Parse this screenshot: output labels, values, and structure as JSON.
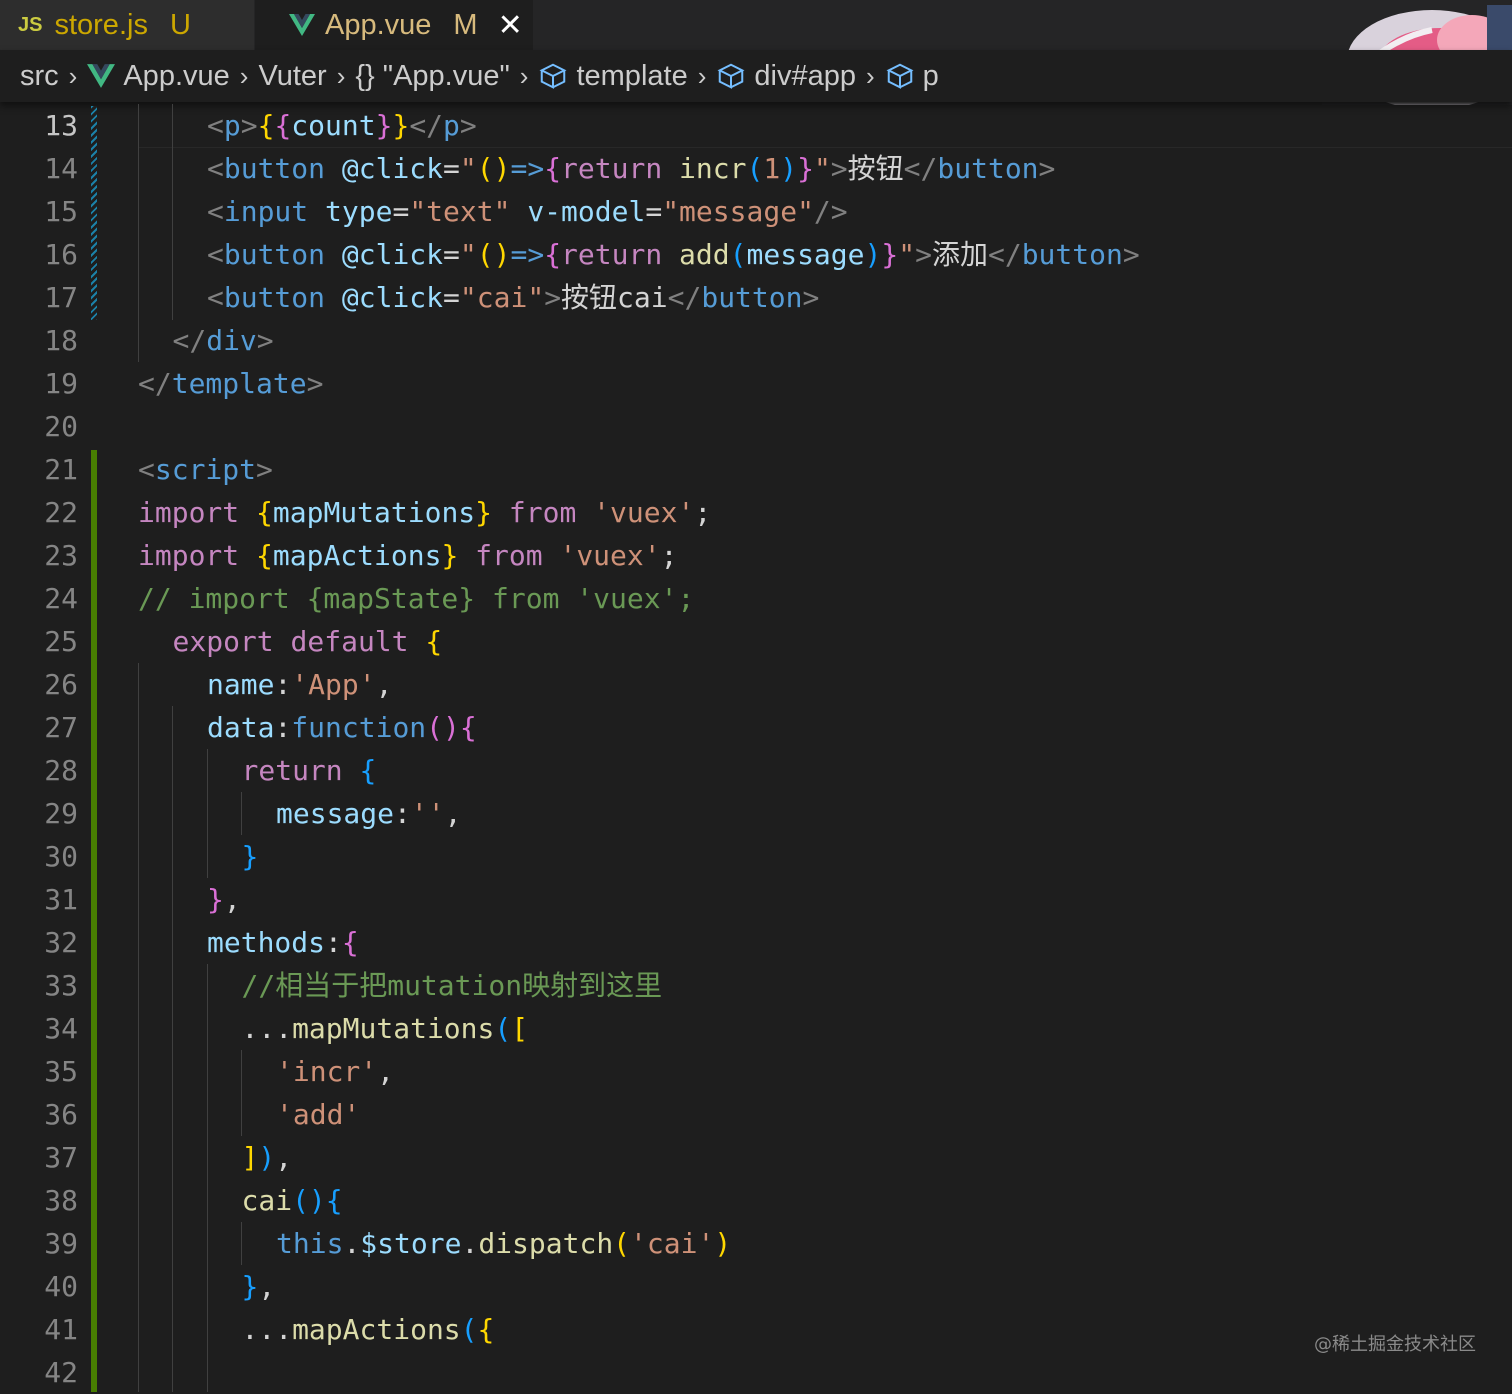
{
  "tabs": [
    {
      "icon": "JS",
      "label": "store.js",
      "status": "U"
    },
    {
      "label": "App.vue",
      "status": "M",
      "close": "✕"
    }
  ],
  "breadcrumb": [
    "src",
    "App.vue",
    "Vuter",
    "{} \"App.vue\"",
    "template",
    "div#app",
    "p"
  ],
  "watermark": "@稀土掘金技术社区",
  "colors": {
    "tag_bracket": "#808080",
    "tag_name": "#569cd6",
    "attribute": "#9cdcfe",
    "string": "#ce9178",
    "keyword": "#c586c0",
    "function": "#dcdcaa",
    "comment": "#6a9955",
    "text": "#d4d4d4",
    "bracket_gold": "#ffd700",
    "bracket_pink": "#da70d6",
    "bracket_blue": "#179fff"
  },
  "code_lines": [
    {
      "n": "13",
      "current": true,
      "indent": 2,
      "tokens": [
        [
          "<",
          "br"
        ],
        [
          "p",
          "tag"
        ],
        [
          ">",
          "br"
        ],
        [
          "{",
          "gold"
        ],
        [
          "{",
          "pink"
        ],
        [
          "count",
          "attr"
        ],
        [
          "}",
          "pink"
        ],
        [
          "}",
          "gold"
        ],
        [
          "</",
          "br"
        ],
        [
          "p",
          "tag"
        ],
        [
          ">",
          "br"
        ]
      ]
    },
    {
      "n": "14",
      "indent": 2,
      "tokens": [
        [
          "<",
          "br"
        ],
        [
          "button",
          "tag"
        ],
        [
          " ",
          "t"
        ],
        [
          "@click",
          "attr"
        ],
        [
          "=",
          "t"
        ],
        [
          "\"",
          "str"
        ],
        [
          "()",
          "gold"
        ],
        [
          "=>",
          "tag"
        ],
        [
          "{",
          "pink"
        ],
        [
          "return",
          "kw"
        ],
        [
          " incr",
          "fn"
        ],
        [
          "(",
          "blue"
        ],
        [
          "1",
          "str"
        ],
        [
          ")",
          "blue"
        ],
        [
          "}",
          "pink"
        ],
        [
          "\"",
          "str"
        ],
        [
          ">",
          "br"
        ],
        [
          "按钮",
          "t"
        ],
        [
          "</",
          "br"
        ],
        [
          "button",
          "tag"
        ],
        [
          ">",
          "br"
        ]
      ]
    },
    {
      "n": "15",
      "indent": 2,
      "tokens": [
        [
          "<",
          "br"
        ],
        [
          "input",
          "tag"
        ],
        [
          " ",
          "t"
        ],
        [
          "type",
          "attr"
        ],
        [
          "=",
          "t"
        ],
        [
          "\"text\"",
          "str"
        ],
        [
          " ",
          "t"
        ],
        [
          "v-model",
          "attr"
        ],
        [
          "=",
          "t"
        ],
        [
          "\"message\"",
          "str"
        ],
        [
          "/>",
          "br"
        ]
      ]
    },
    {
      "n": "16",
      "indent": 2,
      "tokens": [
        [
          "<",
          "br"
        ],
        [
          "button",
          "tag"
        ],
        [
          " ",
          "t"
        ],
        [
          "@click",
          "attr"
        ],
        [
          "=",
          "t"
        ],
        [
          "\"",
          "str"
        ],
        [
          "()",
          "gold"
        ],
        [
          "=>",
          "tag"
        ],
        [
          "{",
          "pink"
        ],
        [
          "return",
          "kw"
        ],
        [
          " add",
          "fn"
        ],
        [
          "(",
          "blue"
        ],
        [
          "message",
          "attr"
        ],
        [
          ")",
          "blue"
        ],
        [
          "}",
          "pink"
        ],
        [
          "\"",
          "str"
        ],
        [
          ">",
          "br"
        ],
        [
          "添加",
          "t"
        ],
        [
          "</",
          "br"
        ],
        [
          "button",
          "tag"
        ],
        [
          ">",
          "br"
        ]
      ]
    },
    {
      "n": "17",
      "indent": 2,
      "tokens": [
        [
          "<",
          "br"
        ],
        [
          "button",
          "tag"
        ],
        [
          " ",
          "t"
        ],
        [
          "@click",
          "attr"
        ],
        [
          "=",
          "t"
        ],
        [
          "\"cai\"",
          "str"
        ],
        [
          ">",
          "br"
        ],
        [
          "按钮cai",
          "t"
        ],
        [
          "</",
          "br"
        ],
        [
          "button",
          "tag"
        ],
        [
          ">",
          "br"
        ]
      ]
    },
    {
      "n": "18",
      "indent": 1,
      "tokens": [
        [
          "</",
          "br"
        ],
        [
          "div",
          "tag"
        ],
        [
          ">",
          "br"
        ]
      ]
    },
    {
      "n": "19",
      "indent": 0,
      "tokens": [
        [
          "</",
          "br"
        ],
        [
          "template",
          "tag"
        ],
        [
          ">",
          "br"
        ]
      ]
    },
    {
      "n": "20",
      "indent": 0,
      "tokens": []
    },
    {
      "n": "21",
      "indent": 0,
      "tokens": [
        [
          "<",
          "br"
        ],
        [
          "script",
          "tag"
        ],
        [
          ">",
          "br"
        ]
      ]
    },
    {
      "n": "22",
      "indent": 0,
      "tokens": [
        [
          "import",
          "kw"
        ],
        [
          " ",
          "t"
        ],
        [
          "{",
          "gold"
        ],
        [
          "mapMutations",
          "attr"
        ],
        [
          "}",
          "gold"
        ],
        [
          " from",
          "kw"
        ],
        [
          " 'vuex'",
          "str"
        ],
        [
          ";",
          "t"
        ]
      ]
    },
    {
      "n": "23",
      "indent": 0,
      "tokens": [
        [
          "import",
          "kw"
        ],
        [
          " ",
          "t"
        ],
        [
          "{",
          "gold"
        ],
        [
          "mapActions",
          "attr"
        ],
        [
          "}",
          "gold"
        ],
        [
          " from",
          "kw"
        ],
        [
          " 'vuex'",
          "str"
        ],
        [
          ";",
          "t"
        ]
      ]
    },
    {
      "n": "24",
      "indent": 0,
      "tokens": [
        [
          "// import {mapState} from 'vuex';",
          "cm"
        ]
      ]
    },
    {
      "n": "25",
      "indent": 1,
      "tokens": [
        [
          "export",
          "kw"
        ],
        [
          " default",
          "kw"
        ],
        [
          " ",
          "t"
        ],
        [
          "{",
          "gold"
        ]
      ]
    },
    {
      "n": "26",
      "indent": 2,
      "tokens": [
        [
          "name",
          "attr"
        ],
        [
          ":",
          "t"
        ],
        [
          "'App'",
          "str"
        ],
        [
          ",",
          "t"
        ]
      ]
    },
    {
      "n": "27",
      "indent": 2,
      "tokens": [
        [
          "data",
          "attr"
        ],
        [
          ":",
          "t"
        ],
        [
          "function",
          "tag"
        ],
        [
          "()",
          "pink"
        ],
        [
          "{",
          "pink"
        ]
      ]
    },
    {
      "n": "28",
      "indent": 3,
      "tokens": [
        [
          "return",
          "kw"
        ],
        [
          " ",
          "t"
        ],
        [
          "{",
          "blue"
        ]
      ]
    },
    {
      "n": "29",
      "indent": 4,
      "tokens": [
        [
          "message",
          "attr"
        ],
        [
          ":",
          "t"
        ],
        [
          "''",
          "str"
        ],
        [
          ",",
          "t"
        ]
      ]
    },
    {
      "n": "30",
      "indent": 3,
      "tokens": [
        [
          "}",
          "blue"
        ]
      ]
    },
    {
      "n": "31",
      "indent": 2,
      "tokens": [
        [
          "}",
          "pink"
        ],
        [
          ",",
          "t"
        ]
      ]
    },
    {
      "n": "32",
      "indent": 2,
      "tokens": [
        [
          "methods",
          "attr"
        ],
        [
          ":",
          "t"
        ],
        [
          "{",
          "pink"
        ]
      ]
    },
    {
      "n": "33",
      "indent": 3,
      "tokens": [
        [
          "//相当于把mutation映射到这里",
          "cm"
        ]
      ]
    },
    {
      "n": "34",
      "indent": 3,
      "tokens": [
        [
          "...",
          "t"
        ],
        [
          "mapMutations",
          "fn"
        ],
        [
          "(",
          "blue"
        ],
        [
          "[",
          "gold"
        ]
      ]
    },
    {
      "n": "35",
      "indent": 4,
      "tokens": [
        [
          "'incr'",
          "str"
        ],
        [
          ",",
          "t"
        ]
      ]
    },
    {
      "n": "36",
      "indent": 4,
      "tokens": [
        [
          "'add'",
          "str"
        ]
      ]
    },
    {
      "n": "37",
      "indent": 3,
      "tokens": [
        [
          "]",
          "gold"
        ],
        [
          ")",
          "blue"
        ],
        [
          ",",
          "t"
        ]
      ]
    },
    {
      "n": "38",
      "indent": 3,
      "tokens": [
        [
          "cai",
          "fn"
        ],
        [
          "()",
          "blue"
        ],
        [
          "{",
          "blue"
        ]
      ]
    },
    {
      "n": "39",
      "indent": 4,
      "tokens": [
        [
          "this",
          "tag"
        ],
        [
          ".",
          "t"
        ],
        [
          "$store",
          "attr"
        ],
        [
          ".",
          "t"
        ],
        [
          "dispatch",
          "fn"
        ],
        [
          "(",
          "gold"
        ],
        [
          "'cai'",
          "str"
        ],
        [
          ")",
          "gold"
        ]
      ]
    },
    {
      "n": "40",
      "indent": 3,
      "tokens": [
        [
          "}",
          "blue"
        ],
        [
          ",",
          "t"
        ]
      ]
    },
    {
      "n": "41",
      "indent": 3,
      "tokens": [
        [
          "...",
          "t"
        ],
        [
          "mapActions",
          "fn"
        ],
        [
          "(",
          "blue"
        ],
        [
          "{",
          "gold"
        ]
      ]
    },
    {
      "n": "42",
      "indent": 0,
      "tokens": []
    }
  ]
}
